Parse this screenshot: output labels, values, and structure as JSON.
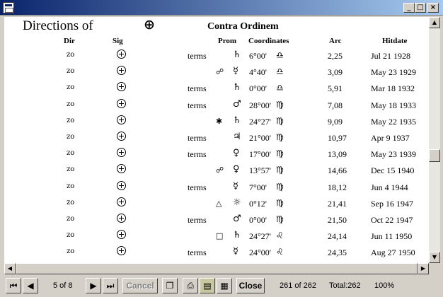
{
  "report": {
    "title": "Directions of",
    "title_symbol": "⊕",
    "subtitle": "Contra Ordinem",
    "headers": {
      "dir": "Dir",
      "sig": "Sig",
      "prom": "Prom",
      "coordinates": "Coordinates",
      "arc": "Arc",
      "hitdate": "Hitdate"
    },
    "rows": [
      {
        "dir": "zo",
        "terms": "terms",
        "aspect": "",
        "planet": "♄",
        "coord": "6°00'",
        "sign": "♎",
        "arc": "2,25",
        "hit": "Jul 21  1928"
      },
      {
        "dir": "zo",
        "terms": "",
        "aspect": "☍",
        "planet": "☿",
        "coord": "4°40'",
        "sign": "♎",
        "arc": "3,09",
        "hit": "May 23  1929"
      },
      {
        "dir": "zo",
        "terms": "terms",
        "aspect": "",
        "planet": "♄",
        "coord": "0°00'",
        "sign": "♎",
        "arc": "5,91",
        "hit": "Mar 18  1932"
      },
      {
        "dir": "zo",
        "terms": "terms",
        "aspect": "",
        "planet": "♂",
        "coord": "28°00'",
        "sign": "♍",
        "arc": "7,08",
        "hit": "May 18  1933"
      },
      {
        "dir": "zo",
        "terms": "",
        "aspect": "✱",
        "planet": "♄",
        "coord": "24°27'",
        "sign": "♍",
        "arc": "9,09",
        "hit": "May 22  1935"
      },
      {
        "dir": "zo",
        "terms": "terms",
        "aspect": "",
        "planet": "♃",
        "coord": "21°00'",
        "sign": "♍",
        "arc": "10,97",
        "hit": "Apr 9  1937"
      },
      {
        "dir": "zo",
        "terms": "terms",
        "aspect": "",
        "planet": "♀",
        "coord": "17°00'",
        "sign": "♍",
        "arc": "13,09",
        "hit": "May 23  1939"
      },
      {
        "dir": "zo",
        "terms": "",
        "aspect": "☍",
        "planet": "♀",
        "coord": "13°57'",
        "sign": "♍",
        "arc": "14,66",
        "hit": "Dec 15  1940"
      },
      {
        "dir": "zo",
        "terms": "terms",
        "aspect": "",
        "planet": "☿",
        "coord": "7°00'",
        "sign": "♍",
        "arc": "18,12",
        "hit": "Jun 4  1944"
      },
      {
        "dir": "zo",
        "terms": "",
        "aspect": "△",
        "planet": "☼",
        "coord": "0°12'",
        "sign": "♍",
        "arc": "21,41",
        "hit": "Sep 16  1947"
      },
      {
        "dir": "zo",
        "terms": "terms",
        "aspect": "",
        "planet": "♂",
        "coord": "0°00'",
        "sign": "♍",
        "arc": "21,50",
        "hit": "Oct 22  1947"
      },
      {
        "dir": "zo",
        "terms": "",
        "aspect": "□",
        "planet": "♄",
        "coord": "24°27'",
        "sign": "♌",
        "arc": "24,14",
        "hit": "Jun 11  1950"
      },
      {
        "dir": "zo",
        "terms": "terms",
        "aspect": "",
        "planet": "☿",
        "coord": "24°00'",
        "sign": "♌",
        "arc": "24,35",
        "hit": "Aug 27  1950"
      }
    ]
  },
  "toolbar": {
    "page_indicator": "5 of 8",
    "cancel_label": "Cancel",
    "close_label": "Close",
    "record_indicator": "261 of 262",
    "total_label": "Total:262",
    "zoom": "100%"
  },
  "icons": {
    "first": "first-page-icon",
    "prev": "prev-page-icon",
    "next": "next-page-icon",
    "last": "last-page-icon",
    "copy": "copy-icon",
    "print": "print-icon",
    "export": "export-icon",
    "setup": "page-setup-icon"
  }
}
